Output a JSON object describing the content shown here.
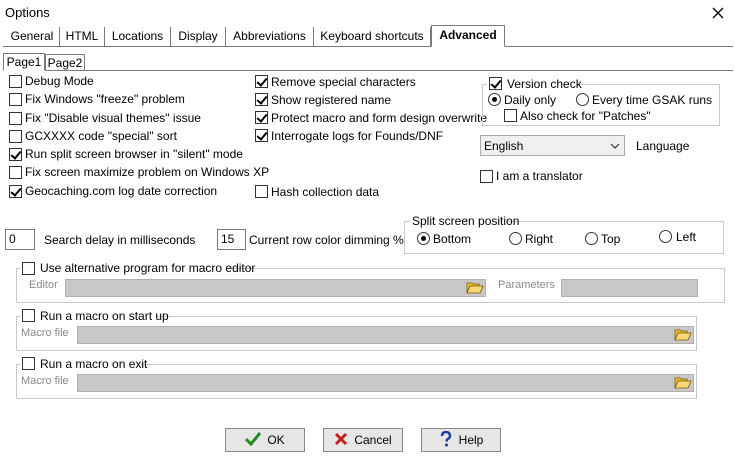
{
  "window": {
    "title": "Options"
  },
  "tabs": [
    "General",
    "HTML",
    "Locations",
    "Display",
    "Abbreviations",
    "Keyboard shortcuts",
    "Advanced"
  ],
  "subtabs": [
    "Page1",
    "Page2"
  ],
  "left_checks": [
    {
      "label": "Debug Mode",
      "checked": false
    },
    {
      "label": "Fix Windows \"freeze\" problem",
      "checked": false
    },
    {
      "label": "Fix \"Disable visual themes\" issue",
      "checked": false
    },
    {
      "label": "GCXXXX code \"special\" sort",
      "checked": false
    },
    {
      "label": "Run split screen browser in \"silent\" mode",
      "checked": true
    },
    {
      "label": "Fix screen maximize problem on Windows XP",
      "checked": false
    },
    {
      "label": "Geocaching.com log date correction",
      "checked": true
    }
  ],
  "mid_checks": [
    {
      "label": "Remove special characters",
      "checked": true
    },
    {
      "label": "Show registered name",
      "checked": true
    },
    {
      "label": "Protect macro and form design overwrite",
      "checked": true
    },
    {
      "label": "Interrogate logs for Founds/DNF",
      "checked": true
    },
    {
      "label": "Hash collection data",
      "checked": false
    }
  ],
  "version": {
    "label": "Version check",
    "daily": "Daily only",
    "every": "Every time GSAK runs",
    "patches": "Also check for \"Patches\""
  },
  "language": {
    "value": "English",
    "label": "Language"
  },
  "translator": "I am a translator",
  "search_delay": {
    "value": "0",
    "label": "Search delay in milliseconds"
  },
  "dimming": {
    "value": "15",
    "label": "Current row color dimming %"
  },
  "split": {
    "label": "Split screen position",
    "options": [
      "Bottom",
      "Right",
      "Top",
      "Left"
    ],
    "selected": "Bottom"
  },
  "alt_editor": {
    "label": "Use alternative program for macro editor",
    "editor": "Editor",
    "params": "Parameters"
  },
  "macro_start": {
    "label": "Run a macro on start up",
    "field": "Macro file"
  },
  "macro_exit": {
    "label": "Run a macro on exit",
    "field": "Macro file"
  },
  "buttons": {
    "ok": "OK",
    "cancel": "Cancel",
    "help": "Help"
  },
  "icons": [
    "close-icon",
    "checkmark-icon",
    "cross-icon",
    "question-icon",
    "folder-open-icon",
    "chevron-down-icon"
  ]
}
